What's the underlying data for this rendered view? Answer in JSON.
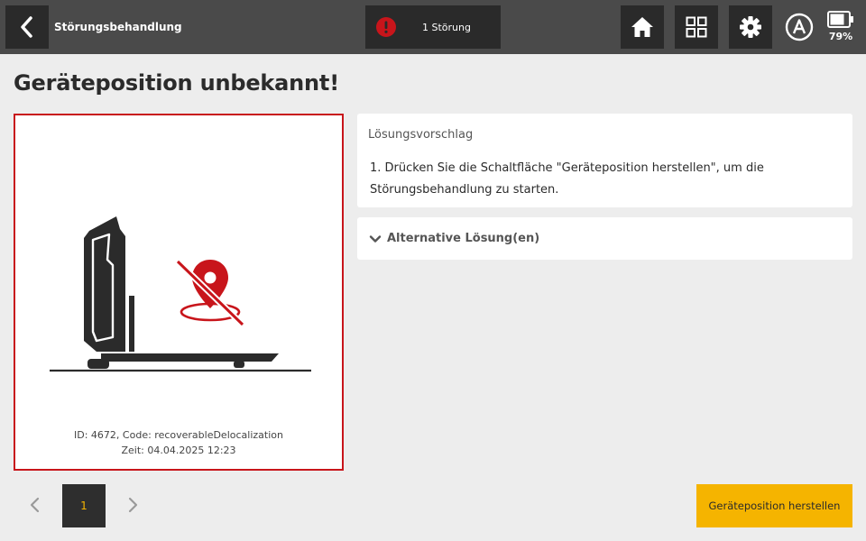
{
  "header": {
    "title": "Störungsbehandlung",
    "fault_count_label": "1 Störung",
    "battery_label": "79%",
    "battery_level": 0.79,
    "icons": {
      "back": "chevron-left-icon",
      "fault": "alert-icon",
      "home": "home-icon",
      "grid": "grid-icon",
      "settings": "gear-icon",
      "auto": "auto-mode-icon",
      "battery": "battery-icon"
    }
  },
  "page": {
    "title": "Geräteposition unbekannt!"
  },
  "image_card": {
    "meta_line1": "ID: 4672, Code: recoverableDelocalization",
    "meta_line2": "Zeit: 04.04.2025 12:23"
  },
  "solution": {
    "heading": "Lösungsvorschlag",
    "text": "1. Drücken Sie die Schaltfläche \"Geräteposition herstellen\", um die Störungsbehandlung zu starten."
  },
  "alternative": {
    "label": "Alternative Lösung(en)"
  },
  "pager": {
    "current_page": "1"
  },
  "actions": {
    "primary_label": "Geräteposition herstellen"
  },
  "colors": {
    "topbar": "#4a4a4a",
    "button_dark": "#2a2a2a",
    "accent_yellow": "#f5b400",
    "alert_red": "#c8151b",
    "background": "#ededed"
  }
}
